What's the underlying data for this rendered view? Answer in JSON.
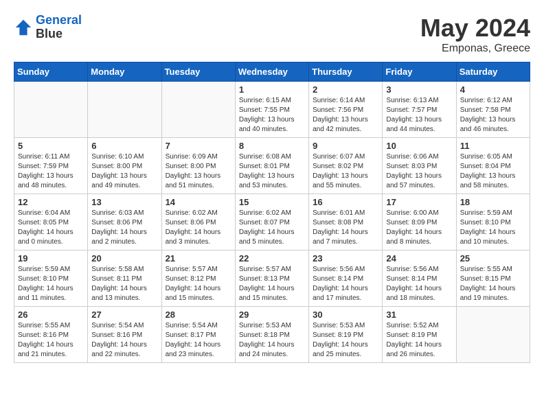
{
  "header": {
    "logo_line1": "General",
    "logo_line2": "Blue",
    "month_year": "May 2024",
    "location": "Emponas, Greece"
  },
  "weekdays": [
    "Sunday",
    "Monday",
    "Tuesday",
    "Wednesday",
    "Thursday",
    "Friday",
    "Saturday"
  ],
  "weeks": [
    [
      {
        "day": "",
        "info": ""
      },
      {
        "day": "",
        "info": ""
      },
      {
        "day": "",
        "info": ""
      },
      {
        "day": "1",
        "info": "Sunrise: 6:15 AM\nSunset: 7:55 PM\nDaylight: 13 hours\nand 40 minutes."
      },
      {
        "day": "2",
        "info": "Sunrise: 6:14 AM\nSunset: 7:56 PM\nDaylight: 13 hours\nand 42 minutes."
      },
      {
        "day": "3",
        "info": "Sunrise: 6:13 AM\nSunset: 7:57 PM\nDaylight: 13 hours\nand 44 minutes."
      },
      {
        "day": "4",
        "info": "Sunrise: 6:12 AM\nSunset: 7:58 PM\nDaylight: 13 hours\nand 46 minutes."
      }
    ],
    [
      {
        "day": "5",
        "info": "Sunrise: 6:11 AM\nSunset: 7:59 PM\nDaylight: 13 hours\nand 48 minutes."
      },
      {
        "day": "6",
        "info": "Sunrise: 6:10 AM\nSunset: 8:00 PM\nDaylight: 13 hours\nand 49 minutes."
      },
      {
        "day": "7",
        "info": "Sunrise: 6:09 AM\nSunset: 8:00 PM\nDaylight: 13 hours\nand 51 minutes."
      },
      {
        "day": "8",
        "info": "Sunrise: 6:08 AM\nSunset: 8:01 PM\nDaylight: 13 hours\nand 53 minutes."
      },
      {
        "day": "9",
        "info": "Sunrise: 6:07 AM\nSunset: 8:02 PM\nDaylight: 13 hours\nand 55 minutes."
      },
      {
        "day": "10",
        "info": "Sunrise: 6:06 AM\nSunset: 8:03 PM\nDaylight: 13 hours\nand 57 minutes."
      },
      {
        "day": "11",
        "info": "Sunrise: 6:05 AM\nSunset: 8:04 PM\nDaylight: 13 hours\nand 58 minutes."
      }
    ],
    [
      {
        "day": "12",
        "info": "Sunrise: 6:04 AM\nSunset: 8:05 PM\nDaylight: 14 hours\nand 0 minutes."
      },
      {
        "day": "13",
        "info": "Sunrise: 6:03 AM\nSunset: 8:06 PM\nDaylight: 14 hours\nand 2 minutes."
      },
      {
        "day": "14",
        "info": "Sunrise: 6:02 AM\nSunset: 8:06 PM\nDaylight: 14 hours\nand 3 minutes."
      },
      {
        "day": "15",
        "info": "Sunrise: 6:02 AM\nSunset: 8:07 PM\nDaylight: 14 hours\nand 5 minutes."
      },
      {
        "day": "16",
        "info": "Sunrise: 6:01 AM\nSunset: 8:08 PM\nDaylight: 14 hours\nand 7 minutes."
      },
      {
        "day": "17",
        "info": "Sunrise: 6:00 AM\nSunset: 8:09 PM\nDaylight: 14 hours\nand 8 minutes."
      },
      {
        "day": "18",
        "info": "Sunrise: 5:59 AM\nSunset: 8:10 PM\nDaylight: 14 hours\nand 10 minutes."
      }
    ],
    [
      {
        "day": "19",
        "info": "Sunrise: 5:59 AM\nSunset: 8:10 PM\nDaylight: 14 hours\nand 11 minutes."
      },
      {
        "day": "20",
        "info": "Sunrise: 5:58 AM\nSunset: 8:11 PM\nDaylight: 14 hours\nand 13 minutes."
      },
      {
        "day": "21",
        "info": "Sunrise: 5:57 AM\nSunset: 8:12 PM\nDaylight: 14 hours\nand 15 minutes."
      },
      {
        "day": "22",
        "info": "Sunrise: 5:57 AM\nSunset: 8:13 PM\nDaylight: 14 hours\nand 15 minutes."
      },
      {
        "day": "23",
        "info": "Sunrise: 5:56 AM\nSunset: 8:14 PM\nDaylight: 14 hours\nand 17 minutes."
      },
      {
        "day": "24",
        "info": "Sunrise: 5:56 AM\nSunset: 8:14 PM\nDaylight: 14 hours\nand 18 minutes."
      },
      {
        "day": "25",
        "info": "Sunrise: 5:55 AM\nSunset: 8:15 PM\nDaylight: 14 hours\nand 19 minutes."
      }
    ],
    [
      {
        "day": "26",
        "info": "Sunrise: 5:55 AM\nSunset: 8:16 PM\nDaylight: 14 hours\nand 21 minutes."
      },
      {
        "day": "27",
        "info": "Sunrise: 5:54 AM\nSunset: 8:16 PM\nDaylight: 14 hours\nand 22 minutes."
      },
      {
        "day": "28",
        "info": "Sunrise: 5:54 AM\nSunset: 8:17 PM\nDaylight: 14 hours\nand 23 minutes."
      },
      {
        "day": "29",
        "info": "Sunrise: 5:53 AM\nSunset: 8:18 PM\nDaylight: 14 hours\nand 24 minutes."
      },
      {
        "day": "30",
        "info": "Sunrise: 5:53 AM\nSunset: 8:19 PM\nDaylight: 14 hours\nand 25 minutes."
      },
      {
        "day": "31",
        "info": "Sunrise: 5:52 AM\nSunset: 8:19 PM\nDaylight: 14 hours\nand 26 minutes."
      },
      {
        "day": "",
        "info": ""
      }
    ]
  ]
}
